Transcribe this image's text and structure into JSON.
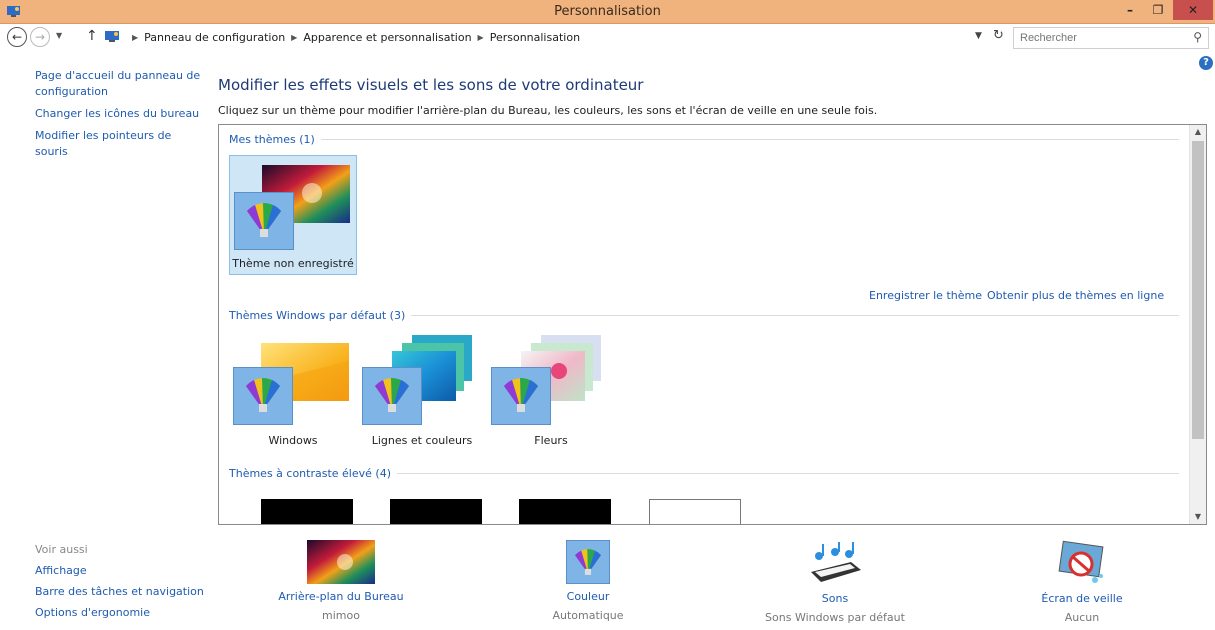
{
  "window": {
    "title": "Personnalisation",
    "min": "–",
    "max": "❐",
    "close": "✕"
  },
  "address": {
    "crumbs": [
      "Panneau de configuration",
      "Apparence et personnalisation",
      "Personnalisation"
    ],
    "search_placeholder": "Rechercher"
  },
  "left": {
    "links": [
      "Page d'accueil du panneau de configuration",
      "Changer les icônes du bureau",
      "Modifier les pointeurs de souris"
    ],
    "see_also_header": "Voir aussi",
    "see_also": [
      "Affichage",
      "Barre des tâches et navigation",
      "Options d'ergonomie"
    ]
  },
  "main": {
    "title": "Modifier les effets visuels et les sons de votre ordinateur",
    "subtitle": "Cliquez sur un thème pour modifier l'arrière-plan du Bureau, les couleurs, les sons et l'écran de veille en une seule fois.",
    "sections": {
      "my": "Mes thèmes (1)",
      "default": "Thèmes Windows par défaut (3)",
      "contrast": "Thèmes à contraste élevé (4)"
    },
    "my_theme": "Thème non enregistré",
    "save_theme": "Enregistrer le thème",
    "more_themes": "Obtenir plus de thèmes en ligne",
    "default_themes": [
      "Windows",
      "Lignes et couleurs",
      "Fleurs"
    ]
  },
  "bottom": [
    {
      "label": "Arrière-plan du Bureau",
      "value": "mimoo"
    },
    {
      "label": "Couleur",
      "value": "Automatique"
    },
    {
      "label": "Sons",
      "value": "Sons Windows par défaut"
    },
    {
      "label": "Écran de veille",
      "value": "Aucun"
    }
  ],
  "colors": {
    "titlebar": "#f0b37e",
    "close": "#c7504f",
    "link": "#1e5bb0",
    "heading": "#1e3a78"
  }
}
